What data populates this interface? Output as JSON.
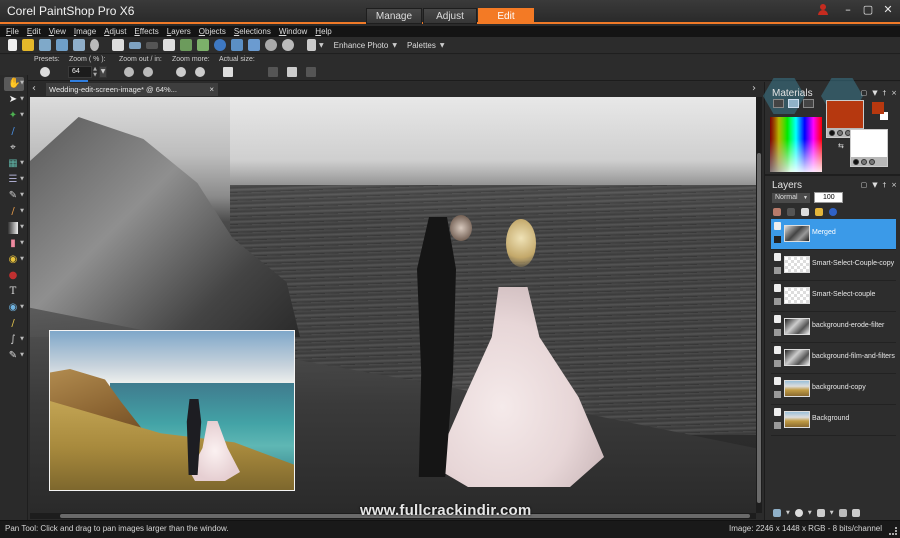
{
  "app": {
    "title": "Corel PaintShop Pro X6"
  },
  "workspace_tabs": [
    {
      "label": "Manage",
      "active": false
    },
    {
      "label": "Adjust",
      "active": false
    },
    {
      "label": "Edit",
      "active": true
    }
  ],
  "window_controls": [
    "user-icon",
    "minimize-icon",
    "maximize-icon",
    "close-icon"
  ],
  "menu": [
    "File",
    "Edit",
    "View",
    "Image",
    "Adjust",
    "Effects",
    "Layers",
    "Objects",
    "Selections",
    "Window",
    "Help"
  ],
  "toolbar": {
    "buttons": [
      "new-file-icon",
      "open-file-icon",
      "scan-icon",
      "save-icon",
      "save-as-icon",
      "share-icon",
      "print-icon",
      "undo-icon",
      "redo-icon",
      "resize-icon",
      "history-back-icon",
      "history-forward-icon",
      "info-icon",
      "actual-size-icon",
      "fit-window-icon",
      "zoom-out-icon",
      "zoom-in-icon",
      "arrange-icon"
    ],
    "enhance_photo": "Enhance Photo",
    "palettes": "Palettes"
  },
  "tool_options": {
    "presets_label": "Presets:",
    "zoom_label": "Zoom ( % ):",
    "zoom_value": "64",
    "zoom_out_in_label": "Zoom out / in:",
    "zoom_more_label": "Zoom more:",
    "actual_size_label": "Actual size:"
  },
  "tools": [
    "pan-tool",
    "pick-tool",
    "selection-tool",
    "dropper-tool",
    "crop-tool",
    "straighten-tool",
    "red-eye-tool",
    "makeover-tool",
    "paint-brush-tool",
    "gradient-tool",
    "eraser-tool",
    "flood-fill-tool",
    "paint-bucket-tool",
    "text-tool",
    "shape-tool",
    "pen-tool",
    "warp-tool",
    "picture-tube-tool"
  ],
  "document": {
    "tab_label": "Wedding-edit-screen-image*  @   64%..."
  },
  "materials": {
    "title": "Materials",
    "foreground_color": "#b6380f",
    "background_color": "#ffffff"
  },
  "layers": {
    "title": "Layers",
    "blend_mode": "Normal",
    "opacity": "100",
    "items": [
      {
        "name": "Merged",
        "selected": true,
        "thumb": "merged"
      },
      {
        "name": "Smart-Select-Couple-copy",
        "selected": false,
        "thumb": "checker"
      },
      {
        "name": "Smart-Select-couple",
        "selected": false,
        "thumb": "checker"
      },
      {
        "name": "background-erode-filter",
        "selected": false,
        "thumb": "bw"
      },
      {
        "name": "background-film-and-filters",
        "selected": false,
        "thumb": "bw"
      },
      {
        "name": "background-copy",
        "selected": false,
        "thumb": "color"
      },
      {
        "name": "Background",
        "selected": false,
        "thumb": "color"
      }
    ]
  },
  "status": {
    "tool_hint": "Pan Tool: Click and drag to pan images larger than the window.",
    "image_info": "Image:  2246 x 1448 x RGB - 8 bits/channel"
  },
  "watermark": "www.fullcrackindir.com",
  "colors": {
    "accent": "#f37a25",
    "selection": "#3b9ae8"
  }
}
